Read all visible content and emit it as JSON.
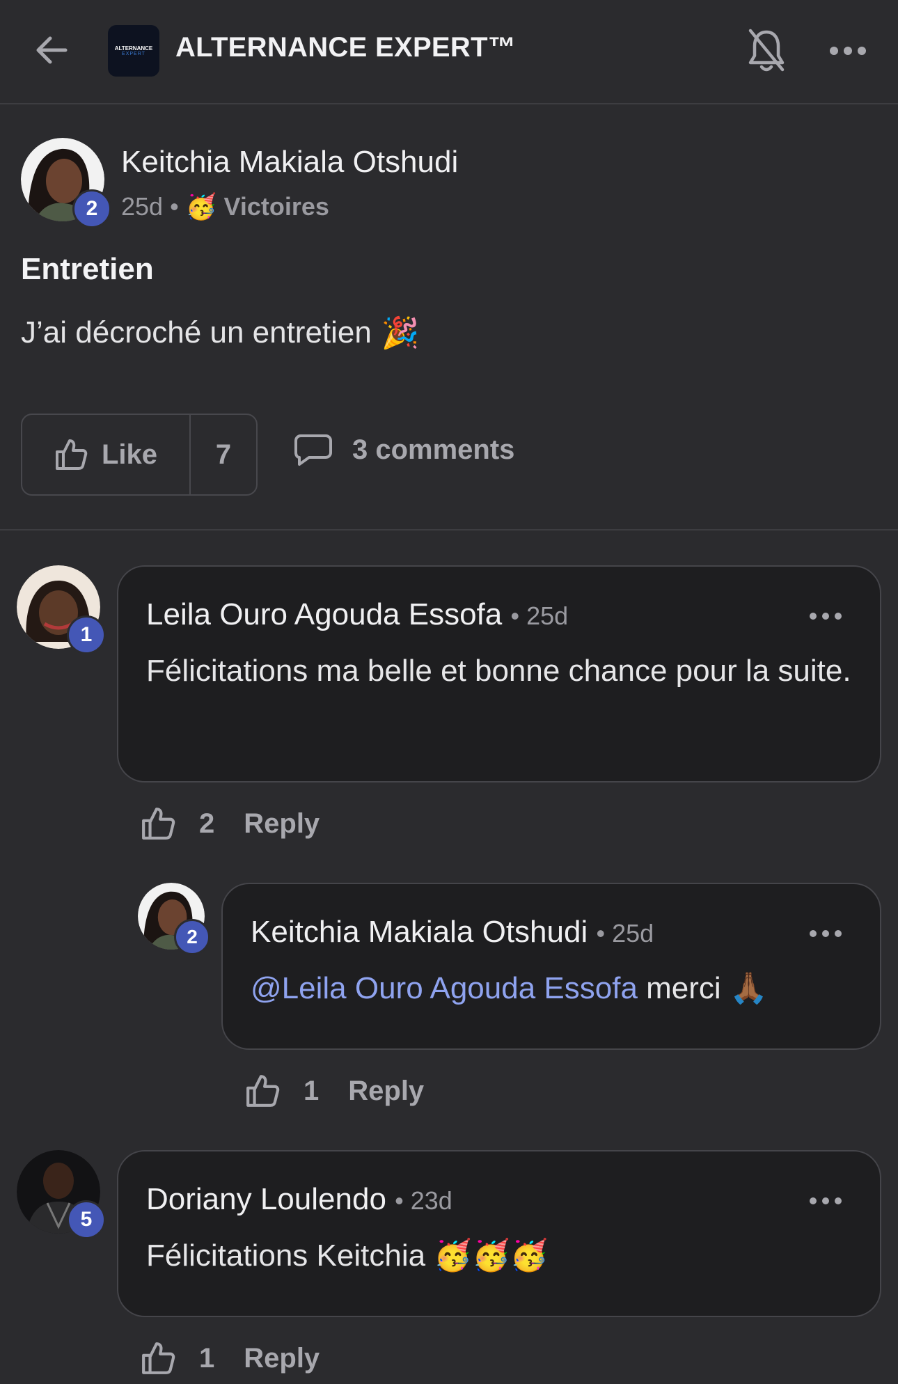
{
  "header": {
    "title": "ALTERNANCE EXPERT™",
    "logo_line1": "ALTERNANCE",
    "logo_line2": "EXPERT"
  },
  "post": {
    "author": "Keitchia Makiala Otshudi",
    "author_level": "2",
    "time": "25d",
    "category_emoji": "🥳",
    "category": "Victoires",
    "title": "Entretien",
    "body": "J’ai décroché un entretien",
    "body_emoji": "🎉",
    "like_label": "Like",
    "like_count": "7",
    "comments_label": "3 comments"
  },
  "comments": [
    {
      "author": "Leila Ouro Agouda Essofa",
      "level": "1",
      "time": "25d",
      "text": "Félicitations ma belle et bonne chance pour la suite.",
      "like_count": "2",
      "reply_label": "Reply"
    },
    {
      "author": "Keitchia Makiala Otshudi",
      "level": "2",
      "time": "25d",
      "mention": "@Leila Ouro Agouda Essofa",
      "text": "merci",
      "emoji": "🙏🏾",
      "like_count": "1",
      "reply_label": "Reply"
    },
    {
      "author": "Doriany Loulendo",
      "level": "5",
      "time": "23d",
      "text": "Félicitations Keitchia",
      "emoji": "🥳🥳🥳",
      "like_count": "1",
      "reply_label": "Reply"
    }
  ],
  "colors": {
    "background": "#2b2b2e",
    "bubble": "#1e1e20",
    "badge": "#4457b6",
    "mention": "#8fa3ef"
  }
}
